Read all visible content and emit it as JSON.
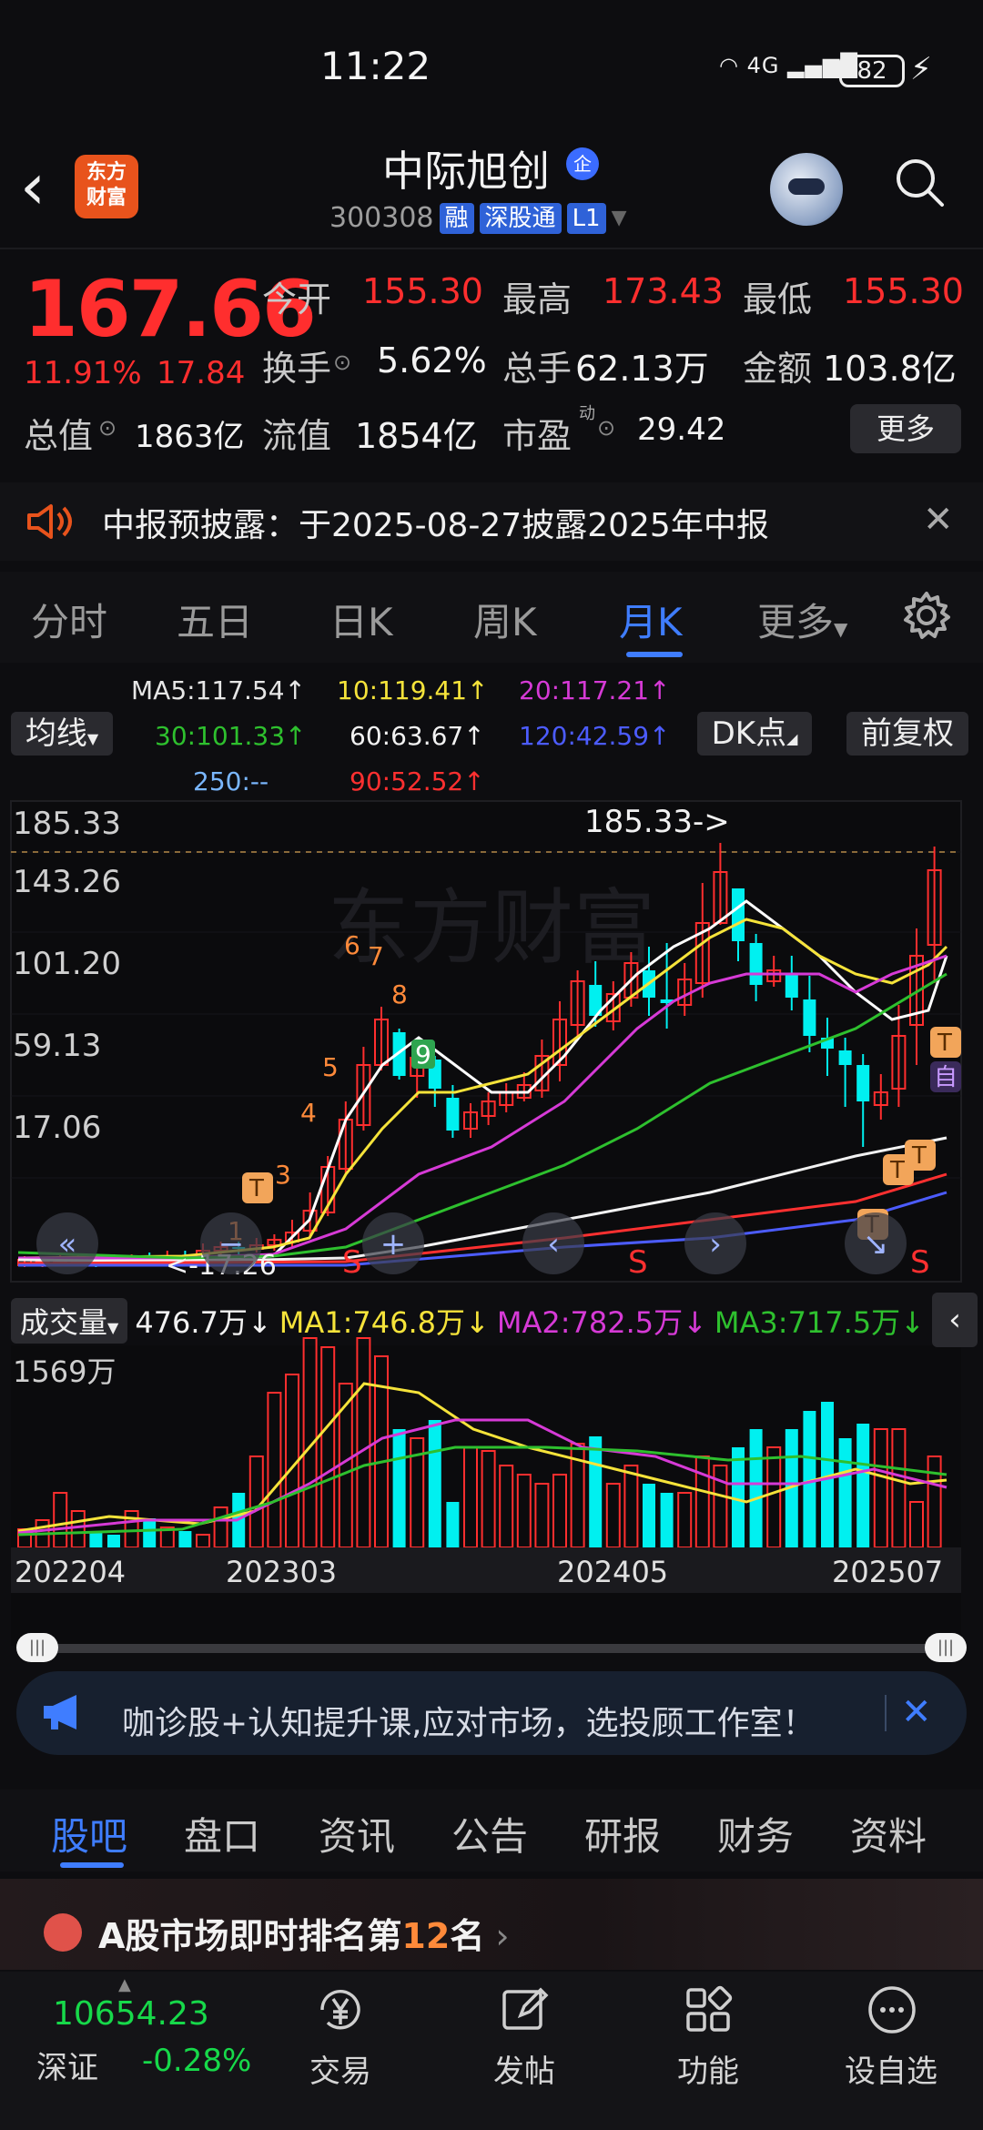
{
  "status_bar": {
    "time": "11:22",
    "network": "4G",
    "battery": "82"
  },
  "header": {
    "stock_name": "中际旭创",
    "badge": "企",
    "code": "300308",
    "tags": [
      "融",
      "深股通",
      "L1"
    ],
    "logo_text": [
      "东方",
      "财富"
    ]
  },
  "quote": {
    "price": "167.66",
    "change_pct": "11.91%",
    "change": "17.84",
    "row1": [
      {
        "label": "今开",
        "value": "155.30"
      },
      {
        "label": "最高",
        "value": "173.43"
      },
      {
        "label": "最低",
        "value": "155.30"
      }
    ],
    "row2": [
      {
        "label": "换手",
        "value": "5.62%"
      },
      {
        "label": "总手",
        "value": "62.13万"
      },
      {
        "label": "金额",
        "value": "103.8亿"
      }
    ],
    "row3": [
      {
        "label": "总值",
        "value": "1863亿"
      },
      {
        "label": "流值",
        "value": "1854亿"
      },
      {
        "label": "市盈",
        "value": "29.42",
        "super": "动"
      }
    ],
    "more_label": "更多"
  },
  "notice": {
    "text": "中报预披露：于2025-08-27披露2025年中报"
  },
  "period_tabs": [
    "分时",
    "五日",
    "日K",
    "周K",
    "月K",
    "更多"
  ],
  "period_active": "月K",
  "ma_panel": {
    "select_label": "均线",
    "dk_label": "DK点",
    "adjust_label": "前复权",
    "items": [
      {
        "label": "MA5:117.54↑",
        "color": "#ffffff"
      },
      {
        "label": "10:119.41↑",
        "color": "#f5e33a"
      },
      {
        "label": "20:117.21↑",
        "color": "#d63ad6"
      },
      {
        "label": "30:101.33↑",
        "color": "#2ec02e"
      },
      {
        "label": "60:63.67↑",
        "color": "#ffffff"
      },
      {
        "label": "120:42.59↑",
        "color": "#4c5cff"
      },
      {
        "label": "250:--",
        "color": "#7ab7ff"
      },
      {
        "label": "90:52.52↑",
        "color": "#ff3030"
      }
    ]
  },
  "chart": {
    "y_labels": [
      "185.33",
      "143.26",
      "101.20",
      "59.13",
      "17.06"
    ],
    "high_marker": "185.33->",
    "low_marker": "<-17.26",
    "watermark": "东方财富",
    "signal_numbers": [
      "1",
      "2",
      "3",
      "4",
      "5",
      "6",
      "7",
      "8",
      "9"
    ],
    "s_marks": [
      "S",
      "S",
      "S"
    ],
    "t_marks": [
      "T",
      "T",
      "T",
      "T",
      "T"
    ],
    "self_mark": "自"
  },
  "volume": {
    "select_label": "成交量",
    "current": "476.7万↓",
    "ma1": "MA1:746.8万↓",
    "ma2": "MA2:782.5万↓",
    "ma3": "MA3:717.5万↓",
    "max_label": "1569万",
    "x_labels": [
      "202204",
      "202303",
      "202405",
      "202507"
    ]
  },
  "ad": {
    "text": "咖诊股+认知提升课,应对市场，选投顾工作室！"
  },
  "info_tabs": [
    "股吧",
    "盘口",
    "资讯",
    "公告",
    "研报",
    "财务",
    "资料"
  ],
  "info_active": "股吧",
  "rank": {
    "prefix": "A股市场即时排名第",
    "rank": "12",
    "suffix": "名"
  },
  "bottom_nav": {
    "index_value": "10654.23",
    "index_name": "深证",
    "index_change": "-0.28%",
    "items": [
      "交易",
      "发帖",
      "功能",
      "设自选"
    ]
  },
  "colors": {
    "up": "#ff2e2e",
    "down": "#00f0f0",
    "accent": "#3f7dff"
  }
}
